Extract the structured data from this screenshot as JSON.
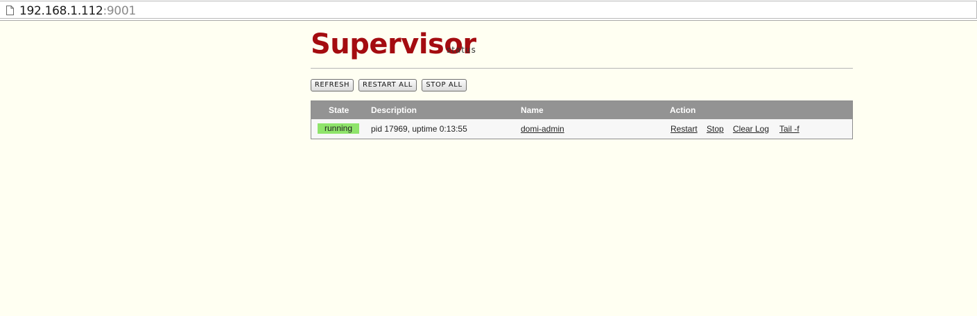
{
  "browser": {
    "url_host": "192.168.1.112",
    "url_port": ":9001",
    "icon": "page-icon"
  },
  "header": {
    "logo_text": "Supervisor",
    "logo_sub": "status",
    "brand_color": "#a40c10"
  },
  "toolbar": {
    "refresh_label": "REFRESH",
    "restart_all_label": "RESTART ALL",
    "stop_all_label": "STOP ALL"
  },
  "table": {
    "columns": [
      "State",
      "Description",
      "Name",
      "Action"
    ],
    "rows": [
      {
        "state": "running",
        "state_color": "#8fe46b",
        "description": "pid 17969, uptime 0:13:55",
        "name": "domi-admin",
        "actions": [
          "Restart",
          "Stop",
          "Clear Log",
          "Tail -f"
        ]
      }
    ]
  }
}
